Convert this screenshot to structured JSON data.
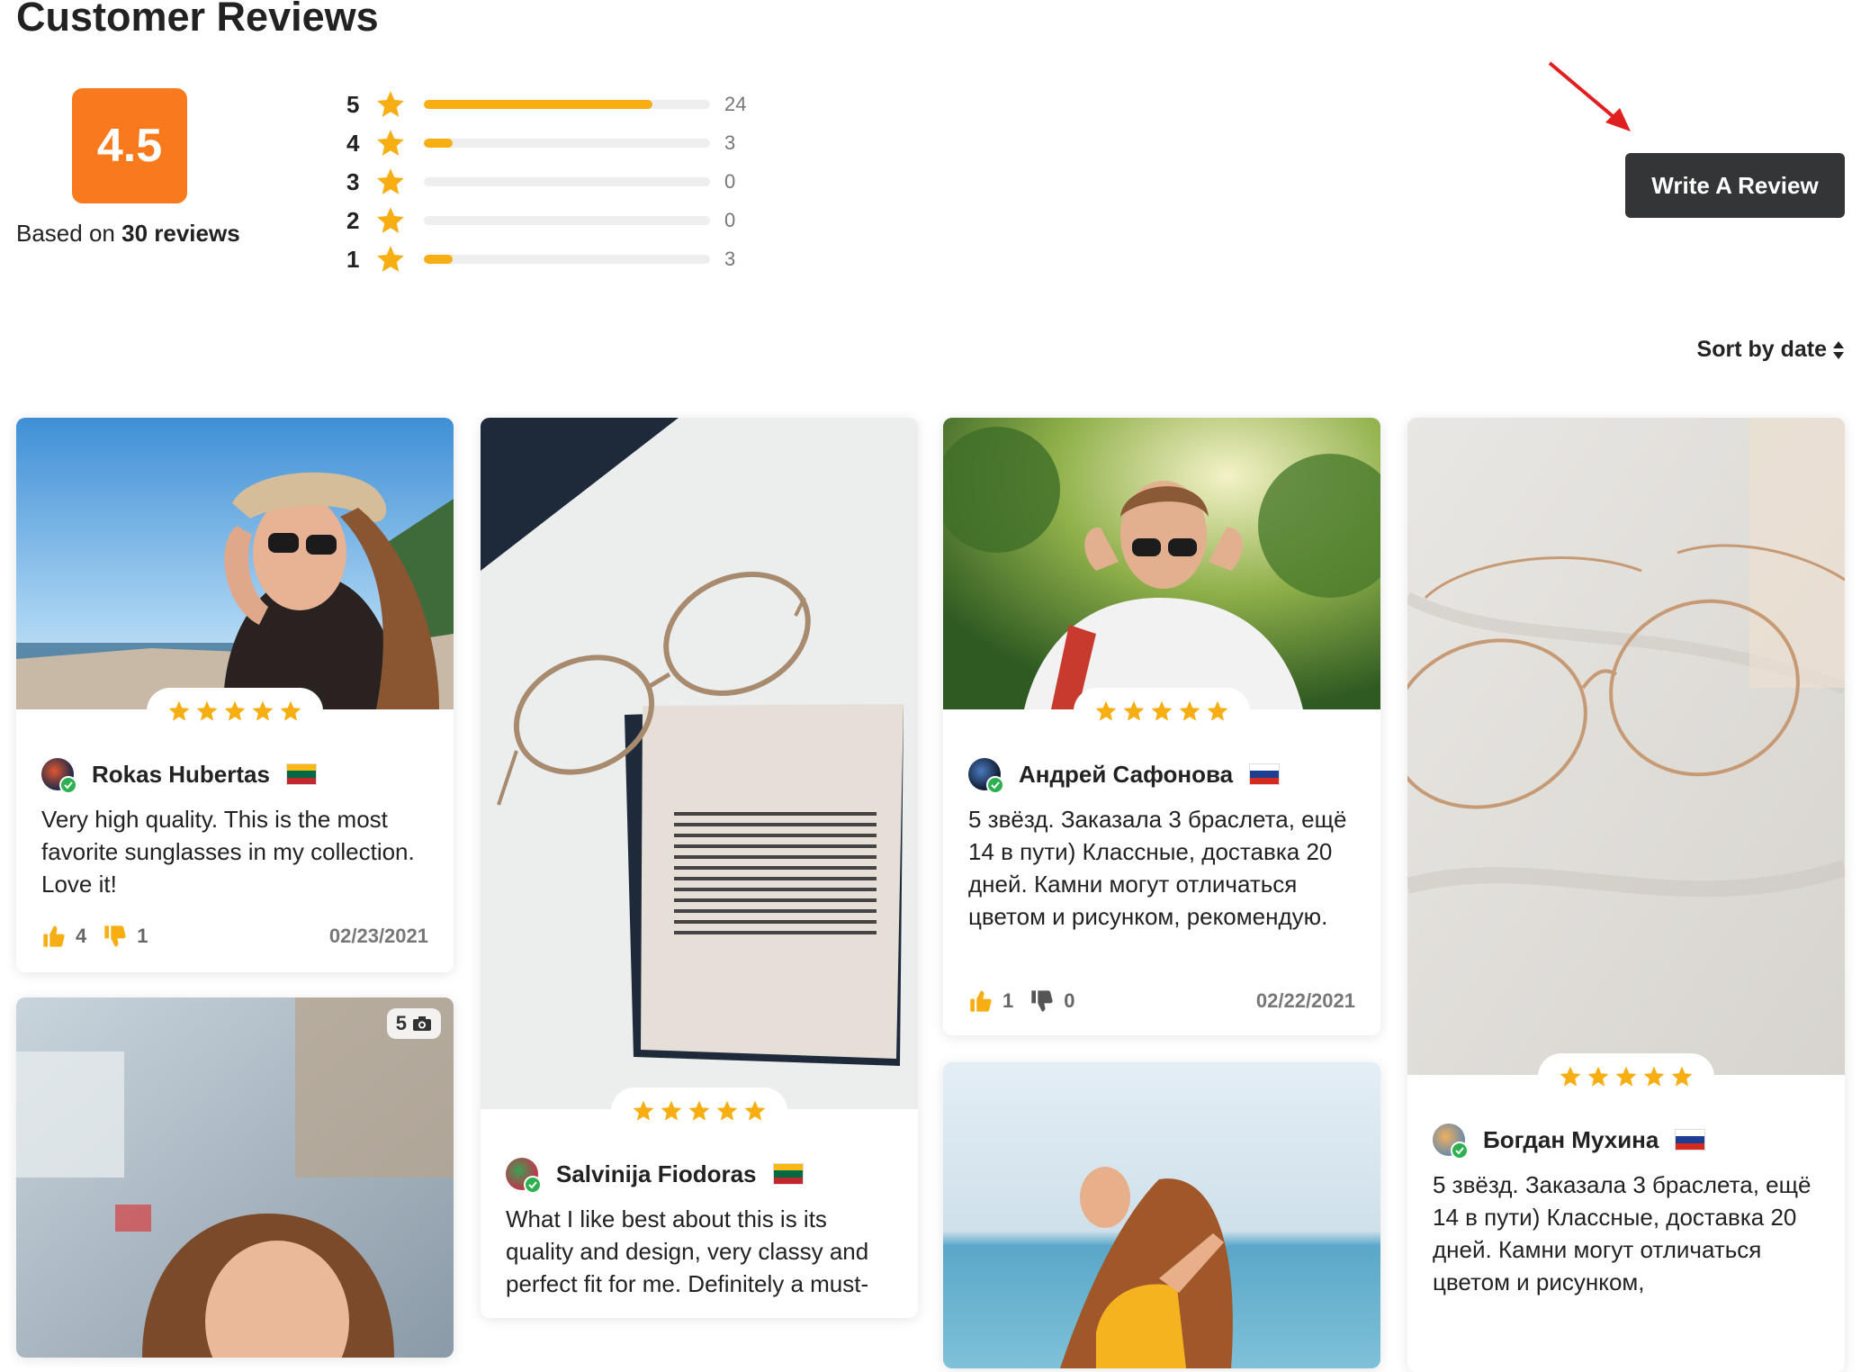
{
  "page": {
    "title": "Customer Reviews"
  },
  "summary": {
    "average": "4.5",
    "based_prefix": "Based on",
    "based_count": "30 reviews",
    "distribution": [
      {
        "stars": "5",
        "count": "24",
        "fraction": 0.8
      },
      {
        "stars": "4",
        "count": "3",
        "fraction": 0.1
      },
      {
        "stars": "3",
        "count": "0",
        "fraction": 0.0
      },
      {
        "stars": "2",
        "count": "0",
        "fraction": 0.0
      },
      {
        "stars": "1",
        "count": "3",
        "fraction": 0.1
      }
    ]
  },
  "actions": {
    "write_review": "Write A Review",
    "sort_label": "Sort by date"
  },
  "colors": {
    "accent": "#f97a1c",
    "star": "#f6ae12",
    "button": "#333536",
    "verified": "#2db150",
    "annotation_arrow": "#e02020"
  },
  "reviews": [
    {
      "author": "Rokas Hubertas",
      "flag": "lithuania",
      "rating": 5,
      "text": "Very high quality. This is the most favorite sunglasses in my collection. Love it!",
      "likes": "4",
      "dislikes": "1",
      "date": "02/23/2021",
      "photo": "woman-in-hat-sunglasses-beach"
    },
    {
      "author": "Salvinija Fiodoras",
      "flag": "lithuania",
      "rating": 5,
      "text": "What I like best about this is its quality and design, very classy and perfect fit for me. Definitely a must-",
      "photo": "eyeglasses-on-paper-note"
    },
    {
      "author": "Андрей Сафонова",
      "flag": "russia",
      "rating": 5,
      "text": "5 звёзд. Заказала 3 браслета, ещё 14 в пути) Классные, доставка 20 дней. Камни могут отличаться цветом и рисунком, рекомендую.",
      "likes": "1",
      "dislikes": "0",
      "date": "02/22/2021",
      "photo": "man-sunglasses-forest"
    },
    {
      "author": "Богдан Мухина",
      "flag": "russia",
      "rating": 5,
      "text": "5 звёзд. Заказала 3 браслета, ещё 14 в пути) Классные, доставка 20 дней. Камни могут отличаться цветом и рисунком,",
      "photo": "eyeglasses-on-fabric"
    },
    {
      "photo": "woman-blurred-portrait",
      "photo_count": "5"
    },
    {
      "photo": "woman-beach-sea"
    }
  ]
}
